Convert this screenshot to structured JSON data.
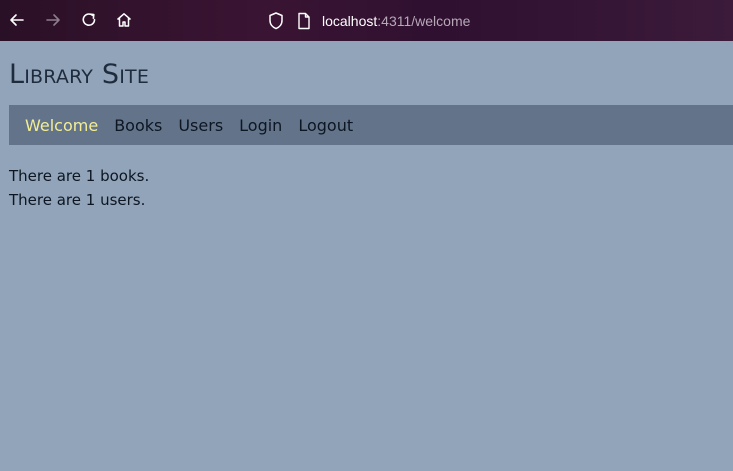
{
  "browser": {
    "url_host": "localhost",
    "url_path": ":4311/welcome",
    "icons": {
      "back": "back-arrow-icon",
      "forward": "forward-arrow-icon",
      "reload": "reload-icon",
      "home": "home-icon",
      "shield": "shield-icon",
      "page": "page-icon"
    }
  },
  "site": {
    "title": "Library Site"
  },
  "nav": {
    "items": [
      {
        "label": "Welcome",
        "active": true
      },
      {
        "label": "Books",
        "active": false
      },
      {
        "label": "Users",
        "active": false
      },
      {
        "label": "Login",
        "active": false
      },
      {
        "label": "Logout",
        "active": false
      }
    ]
  },
  "main": {
    "books_line": "There are 1 books.",
    "users_line": "There are 1 users."
  },
  "colors": {
    "page_background": "#92a4b9",
    "nav_background": "#63748a",
    "nav_active": "#f3ed93",
    "text": "#0d1622"
  }
}
